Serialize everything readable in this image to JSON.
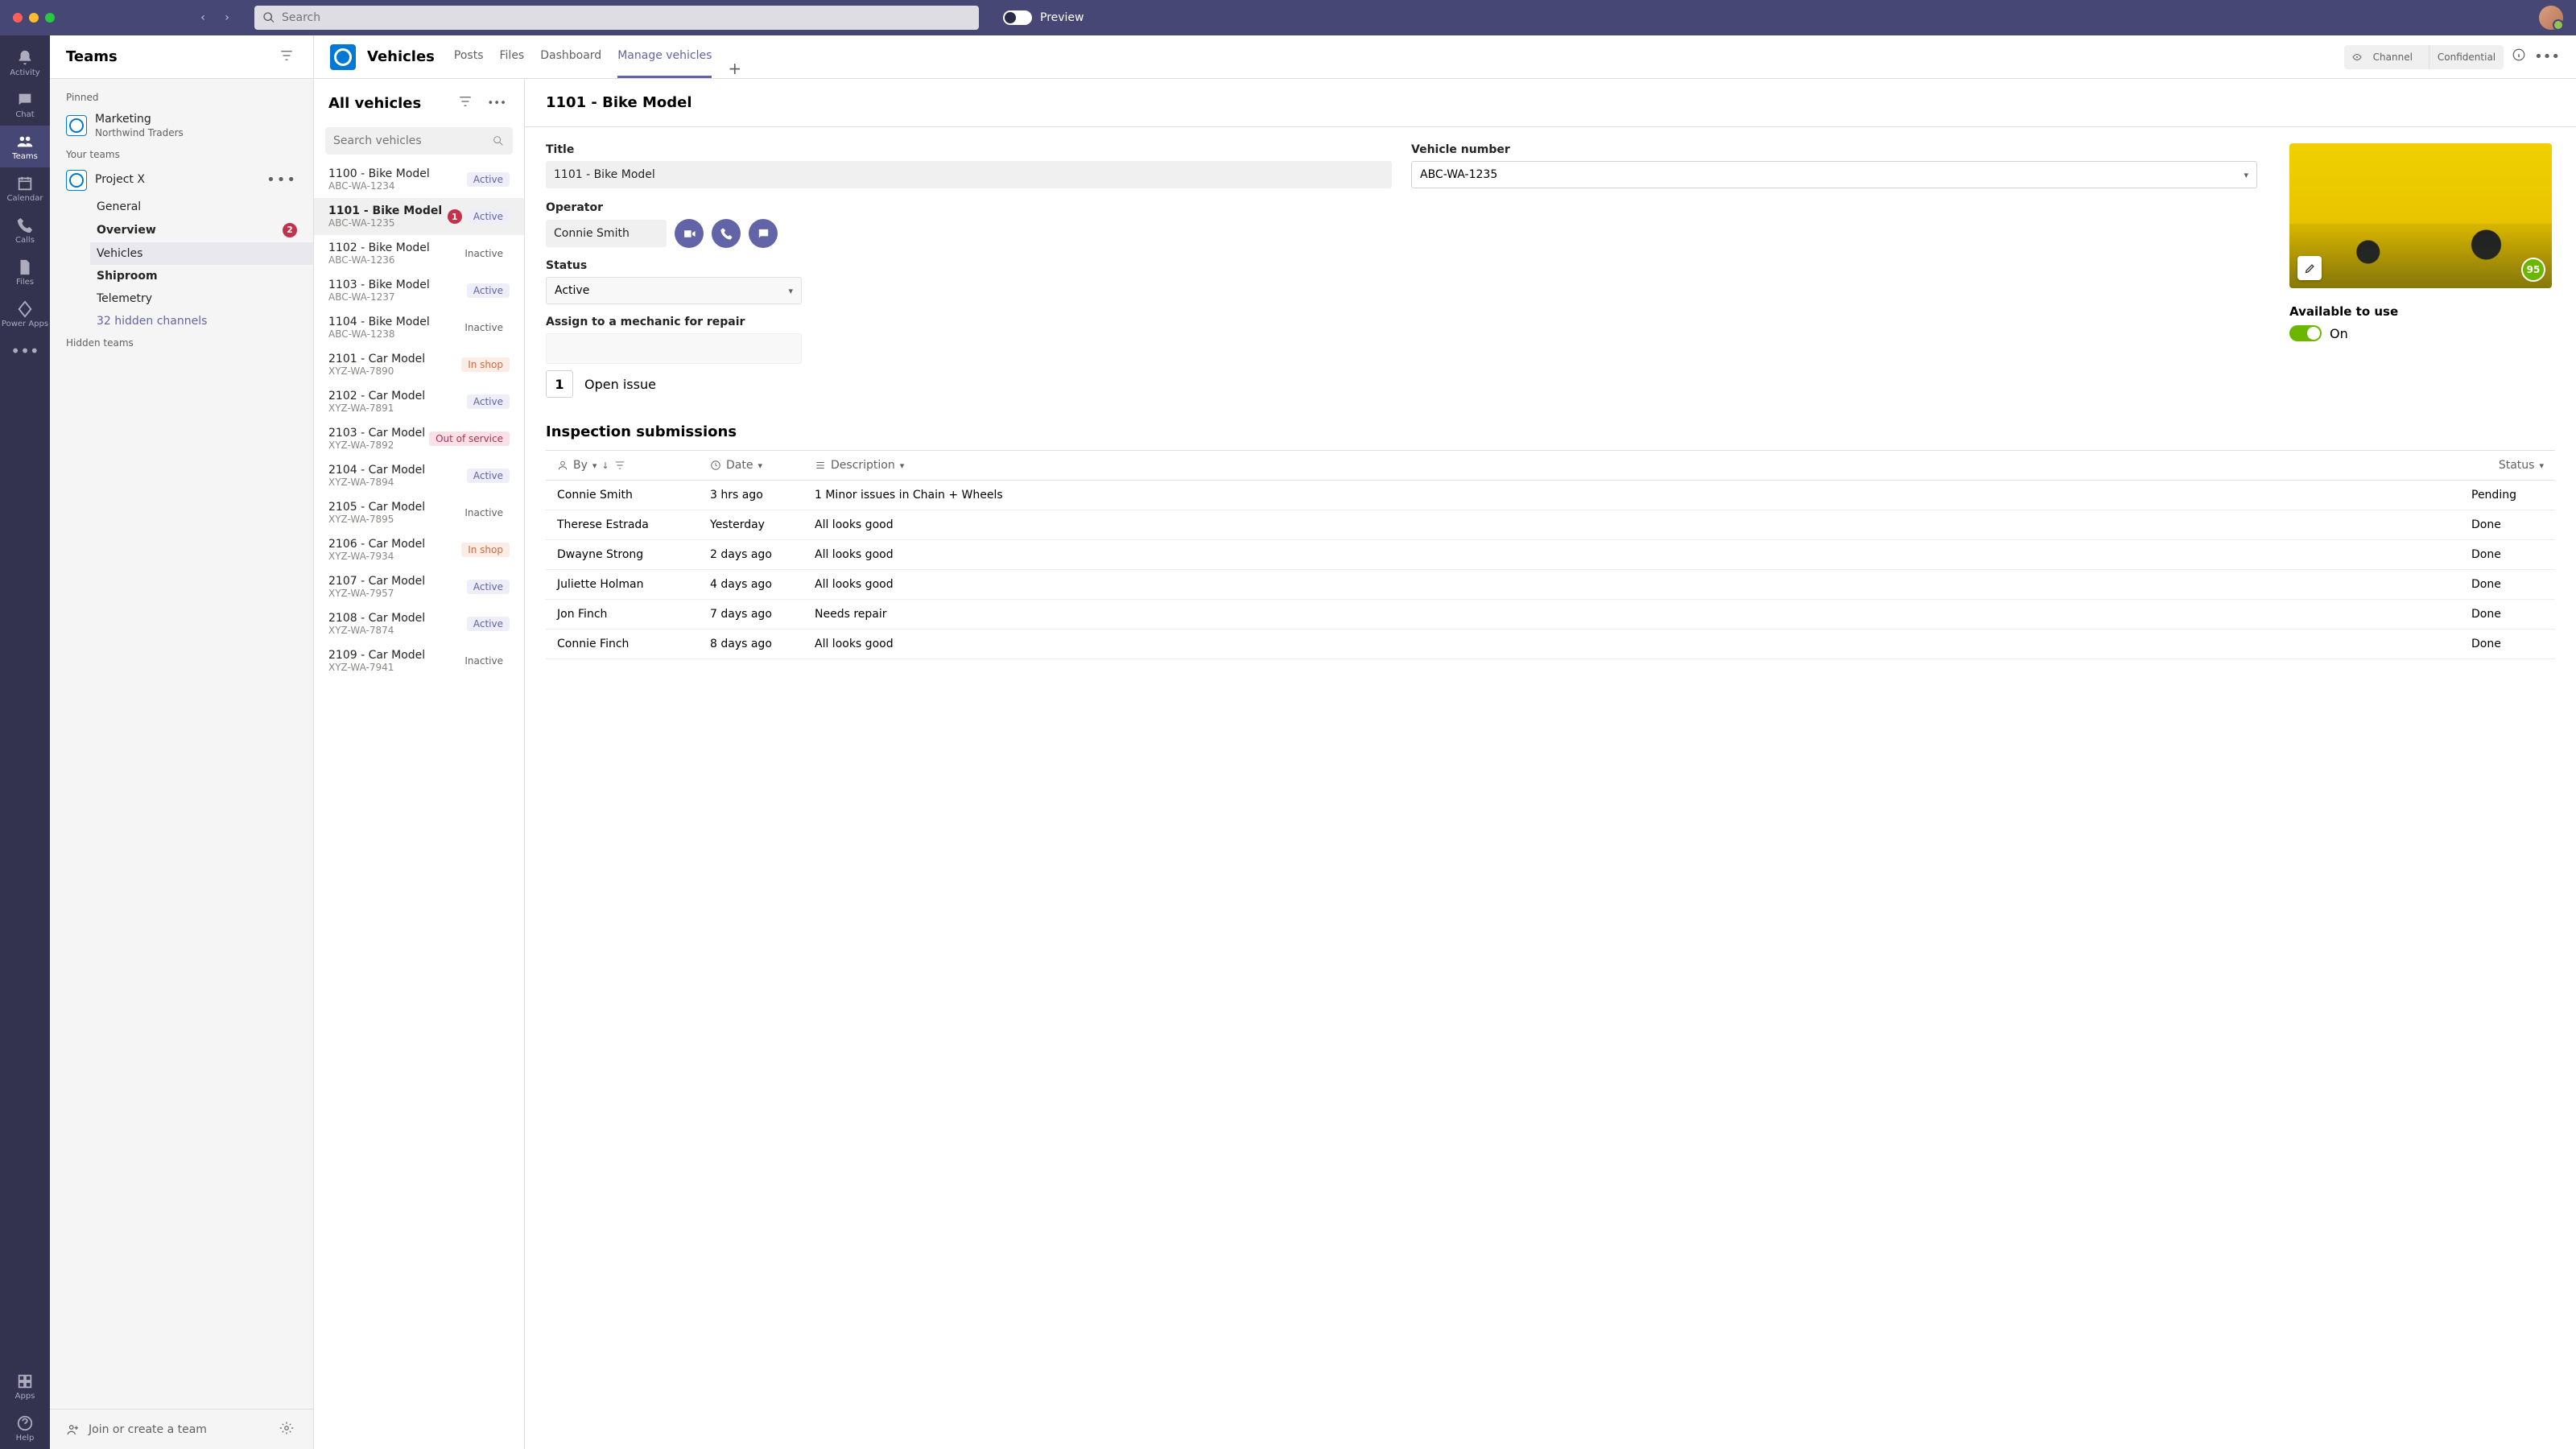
{
  "titlebar": {
    "search_placeholder": "Search",
    "preview_label": "Preview"
  },
  "rail": {
    "items": [
      {
        "label": "Activity"
      },
      {
        "label": "Chat"
      },
      {
        "label": "Teams"
      },
      {
        "label": "Calendar"
      },
      {
        "label": "Calls"
      },
      {
        "label": "Files"
      },
      {
        "label": "Power Apps"
      }
    ],
    "bottom": [
      {
        "label": "Apps"
      },
      {
        "label": "Help"
      }
    ]
  },
  "teams_sidebar": {
    "title": "Teams",
    "section_pinned": "Pinned",
    "pinned": {
      "name": "Marketing",
      "sub": "Northwind Traders"
    },
    "section_your": "Your teams",
    "team": {
      "name": "Project X"
    },
    "channels": [
      {
        "label": "General"
      },
      {
        "label": "Overview",
        "badge": "2"
      },
      {
        "label": "Vehicles"
      },
      {
        "label": "Shiproom"
      },
      {
        "label": "Telemetry"
      }
    ],
    "hidden_channels": "32 hidden channels",
    "section_hidden": "Hidden teams",
    "footer_join": "Join or create a team"
  },
  "channel_header": {
    "title": "Vehicles",
    "tabs": [
      {
        "label": "Posts"
      },
      {
        "label": "Files"
      },
      {
        "label": "Dashboard"
      },
      {
        "label": "Manage vehicles"
      }
    ],
    "channel_pill": "Channel",
    "confidential_pill": "Confidential"
  },
  "vehicle_list": {
    "title": "All vehicles",
    "search_placeholder": "Search vehicles",
    "items": [
      {
        "name": "1100 - Bike Model",
        "sub": "ABC-WA-1234",
        "status": "Active",
        "cls": "st-active"
      },
      {
        "name": "1101 - Bike Model",
        "sub": "ABC-WA-1235",
        "status": "Active",
        "cls": "st-active",
        "alert": "1",
        "selected": true
      },
      {
        "name": "1102 - Bike Model",
        "sub": "ABC-WA-1236",
        "status": "Inactive",
        "cls": "st-inactive"
      },
      {
        "name": "1103 - Bike Model",
        "sub": "ABC-WA-1237",
        "status": "Active",
        "cls": "st-active"
      },
      {
        "name": "1104 - Bike Model",
        "sub": "ABC-WA-1238",
        "status": "Inactive",
        "cls": "st-inactive"
      },
      {
        "name": "2101 - Car Model",
        "sub": "XYZ-WA-7890",
        "status": "In shop",
        "cls": "st-inshop"
      },
      {
        "name": "2102 - Car Model",
        "sub": "XYZ-WA-7891",
        "status": "Active",
        "cls": "st-active"
      },
      {
        "name": "2103 - Car Model",
        "sub": "XYZ-WA-7892",
        "status": "Out of service",
        "cls": "st-out"
      },
      {
        "name": "2104 - Car Model",
        "sub": "XYZ-WA-7894",
        "status": "Active",
        "cls": "st-active"
      },
      {
        "name": "2105 - Car Model",
        "sub": "XYZ-WA-7895",
        "status": "Inactive",
        "cls": "st-inactive"
      },
      {
        "name": "2106 - Car Model",
        "sub": "XYZ-WA-7934",
        "status": "In shop",
        "cls": "st-inshop"
      },
      {
        "name": "2107 - Car Model",
        "sub": "XYZ-WA-7957",
        "status": "Active",
        "cls": "st-active"
      },
      {
        "name": "2108 - Car Model",
        "sub": "XYZ-WA-7874",
        "status": "Active",
        "cls": "st-active"
      },
      {
        "name": "2109 - Car Model",
        "sub": "XYZ-WA-7941",
        "status": "Inactive",
        "cls": "st-inactive"
      }
    ]
  },
  "detail": {
    "header": "1101 - Bike Model",
    "title_label": "Title",
    "title_value": "1101 - Bike Model",
    "number_label": "Vehicle number",
    "number_value": "ABC-WA-1235",
    "operator_label": "Operator",
    "operator_value": "Connie Smith",
    "status_label": "Status",
    "status_value": "Active",
    "assign_label": "Assign to a mechanic for repair",
    "open_issue_count": "1",
    "open_issue_label": "Open issue",
    "score": "95",
    "available_label": "Available to use",
    "available_state": "On"
  },
  "inspections": {
    "title": "Inspection submissions",
    "col_by": "By",
    "col_date": "Date",
    "col_desc": "Description",
    "col_status": "Status",
    "rows": [
      {
        "by": "Connie Smith",
        "date": "3 hrs ago",
        "desc": "1 Minor issues in Chain + Wheels",
        "status": "Pending"
      },
      {
        "by": "Therese Estrada",
        "date": "Yesterday",
        "desc": "All looks good",
        "status": "Done"
      },
      {
        "by": "Dwayne Strong",
        "date": "2 days ago",
        "desc": "All looks good",
        "status": "Done"
      },
      {
        "by": "Juliette Holman",
        "date": "4 days ago",
        "desc": "All looks good",
        "status": "Done"
      },
      {
        "by": "Jon Finch",
        "date": "7 days ago",
        "desc": "Needs repair",
        "status": "Done"
      },
      {
        "by": "Connie Finch",
        "date": "8 days ago",
        "desc": "All looks good",
        "status": "Done"
      }
    ]
  }
}
